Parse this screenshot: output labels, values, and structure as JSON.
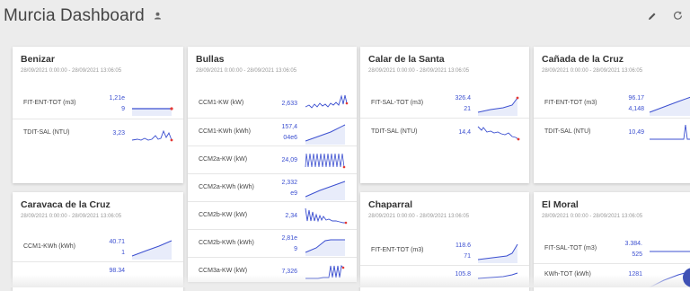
{
  "header": {
    "title": "Murcia Dashboard",
    "title_icon": "person-icon",
    "edit_icon": "pencil-icon",
    "refresh_icon": "refresh-icon"
  },
  "colors": {
    "accent": "#3b4fd0",
    "alert": "#e53935",
    "sparkline_fill": "#e8ecfa"
  },
  "cards": [
    {
      "name": "benizar",
      "title": "Benizar",
      "date": "28/09/2021 0:00:00 - 28/09/2021 13:06:05",
      "rows": [
        {
          "label": "FIT-ENT-TOT (m3)",
          "value": "1,21e",
          "value2": "9"
        },
        {
          "label": "TDIT-SAL (NTU)",
          "value": "3,23",
          "value2": ""
        }
      ]
    },
    {
      "name": "bullas",
      "title": "Bullas",
      "date": "28/09/2021 0:00:00 - 28/09/2021 13:06:05",
      "rows": [
        {
          "label": "CCM1-KW (kW)",
          "value": "2,633",
          "value2": ""
        },
        {
          "label": "CCM1-KWh (kWh)",
          "value": "157,4",
          "value2": "04e6"
        },
        {
          "label": "CCM2a-KW (kW)",
          "value": "24,09",
          "value2": ""
        },
        {
          "label": "CCM2a-KWh (kWh)",
          "value": "2,332",
          "value2": "e9"
        },
        {
          "label": "CCM2b-KW (kW)",
          "value": "2,34",
          "value2": ""
        },
        {
          "label": "CCM2b-KWh (kWh)",
          "value": "2,81e",
          "value2": "9"
        },
        {
          "label": "CCM3a-KW (kW)",
          "value": "7,326",
          "value2": ""
        }
      ]
    },
    {
      "name": "calar",
      "title": "Calar de la Santa",
      "date": "28/09/2021 0:00:00 - 28/09/2021 13:06:05",
      "rows": [
        {
          "label": "FIT-SAL-TOT (m3)",
          "value": "326.4",
          "value2": "21"
        },
        {
          "label": "TDIT-SAL (NTU)",
          "value": "14,4",
          "value2": ""
        }
      ]
    },
    {
      "name": "canada",
      "title": "Cañada de la Cruz",
      "date": "28/09/2021 0:00:00 - 28/09/2021 13:06:05",
      "rows": [
        {
          "label": "FIT-ENT-TOT (m3)",
          "value": "96.17",
          "value2": "4,148"
        },
        {
          "label": "TDIT-SAL (NTU)",
          "value": "10,49",
          "value2": ""
        }
      ]
    },
    {
      "name": "caravaca",
      "title": "Caravaca de la Cruz",
      "date": "28/09/2021 0:00:00 - 28/09/2021 13:06:05",
      "rows": [
        {
          "label": "CCM1-KWh (kWh)",
          "value": "40.71",
          "value2": "1"
        },
        {
          "label": "",
          "value": "98.34",
          "value2": ""
        }
      ]
    },
    {
      "name": "chaparral",
      "title": "Chaparral",
      "date": "28/09/2021 0:00:00 - 28/09/2021 13:06:05",
      "rows": [
        {
          "label": "FIT-ENT-TOT (m3)",
          "value": "118.6",
          "value2": "71"
        },
        {
          "label": "",
          "value": "105.8",
          "value2": ""
        }
      ]
    },
    {
      "name": "el-moral",
      "title": "El Moral",
      "date": "28/09/2021 0:00:00 - 28/09/2021 13:06:05",
      "rows": [
        {
          "label": "FIT-SAL-TOT (m3)",
          "value": "3.384.",
          "value2": "525"
        },
        {
          "label": "KWh-TOT (kWh)",
          "value": "1281",
          "value2": ""
        }
      ]
    }
  ]
}
